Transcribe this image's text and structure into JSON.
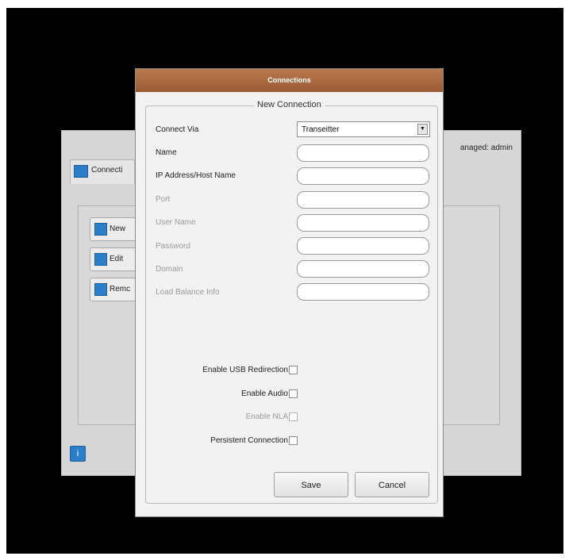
{
  "background_window": {
    "tab_label": "Connecti",
    "managed_text": "anaged: admin",
    "buttons": [
      {
        "label": "New"
      },
      {
        "label": "Edit"
      },
      {
        "label": "Remc"
      }
    ]
  },
  "dialog": {
    "title": "Connections",
    "group_title": "New Connection",
    "connect_via": {
      "label": "Connect Via",
      "value": "Transeitter"
    },
    "fields": [
      {
        "label": "Name",
        "value": "",
        "disabled": false
      },
      {
        "label": "IP Address/Host Name",
        "value": "",
        "disabled": false
      },
      {
        "label": "Port",
        "value": "",
        "disabled": true
      },
      {
        "label": "User Name",
        "value": "",
        "disabled": true
      },
      {
        "label": "Password",
        "value": "",
        "disabled": true
      },
      {
        "label": "Domain",
        "value": "",
        "disabled": true
      },
      {
        "label": "Load Balance Info",
        "value": "",
        "disabled": true
      }
    ],
    "checkboxes": [
      {
        "label": "Enable USB Redirection",
        "checked": false,
        "disabled": false
      },
      {
        "label": "Enable Audio",
        "checked": false,
        "disabled": false
      },
      {
        "label": "Enable NLA",
        "checked": false,
        "disabled": true
      },
      {
        "label": "Persistent Connection",
        "checked": false,
        "disabled": false
      }
    ],
    "save_label": "Save",
    "cancel_label": "Cancel"
  }
}
